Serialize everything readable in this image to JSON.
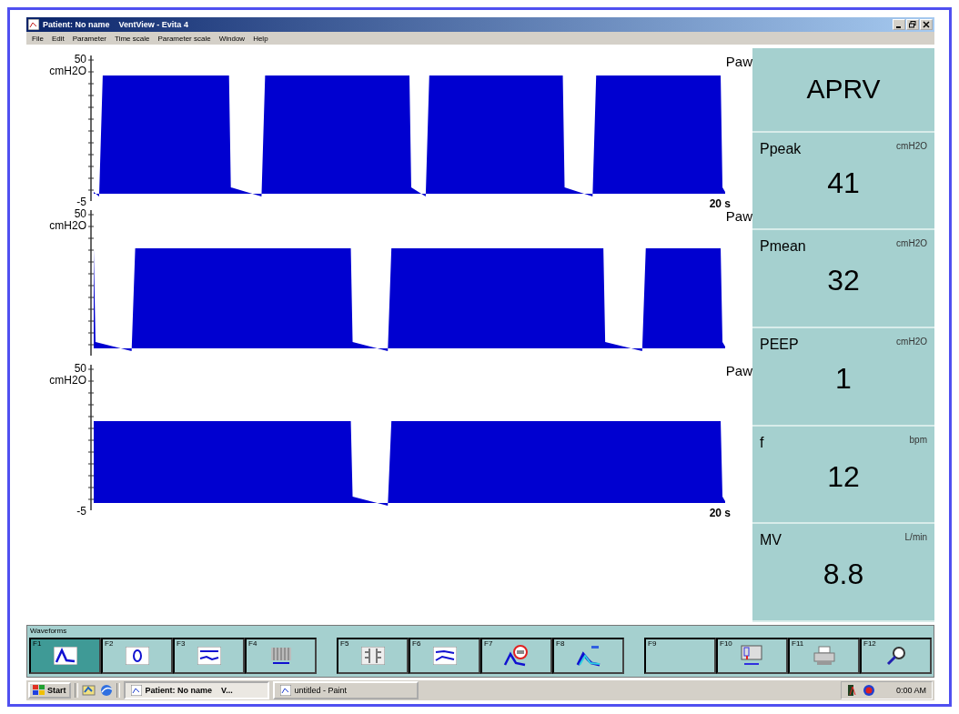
{
  "window": {
    "title": "Patient: No name    VentView - Evita 4"
  },
  "menu": [
    "File",
    "Edit",
    "Parameter",
    "Time scale",
    "Parameter scale",
    "Window",
    "Help"
  ],
  "panels": [
    {
      "y_max": "50",
      "y_min": "-5",
      "unit": "cmH2O",
      "parameter": "Paw",
      "time_label": "20 s"
    },
    {
      "y_max": "50",
      "unit": "cmH2O",
      "parameter": "Paw"
    },
    {
      "y_max": "50",
      "y_min": "-5",
      "unit": "cmH2O",
      "parameter": "Paw",
      "time_label": "20 s"
    }
  ],
  "mode": "APRV",
  "readings": [
    {
      "name": "Ppeak",
      "unit": "cmH2O",
      "value": "41"
    },
    {
      "name": "Pmean",
      "unit": "cmH2O",
      "value": "32"
    },
    {
      "name": "PEEP",
      "unit": "cmH2O",
      "value": "1"
    },
    {
      "name": "f",
      "unit": "bpm",
      "value": "12"
    },
    {
      "name": "MV",
      "unit": "L/min",
      "value": "8.8"
    }
  ],
  "toolbar": {
    "title": "Waveforms",
    "buttons": [
      {
        "key": "F1",
        "kind": "waveform",
        "selected": true
      },
      {
        "key": "F2",
        "kind": "loop",
        "selected": false
      },
      {
        "key": "F3",
        "kind": "trend",
        "selected": false
      },
      {
        "key": "F4",
        "kind": "bars",
        "selected": false
      },
      {
        "key": "F5",
        "kind": "columns",
        "selected": false
      },
      {
        "key": "F6",
        "kind": "screen",
        "selected": false
      },
      {
        "key": "F7",
        "kind": "alarm",
        "selected": false
      },
      {
        "key": "F8",
        "kind": "curves",
        "selected": false
      },
      {
        "key": "F9",
        "kind": "blank",
        "selected": false
      },
      {
        "key": "F10",
        "kind": "menu",
        "selected": false
      },
      {
        "key": "F11",
        "kind": "printer",
        "selected": false
      },
      {
        "key": "F12",
        "kind": "zoom",
        "selected": false
      }
    ]
  },
  "taskbar": {
    "start": "Start",
    "tasks": [
      {
        "label": "Patient: No name    V...",
        "selected": true
      },
      {
        "label": "untitled - Paint",
        "selected": false
      }
    ],
    "clock": "0:00 AM"
  }
}
